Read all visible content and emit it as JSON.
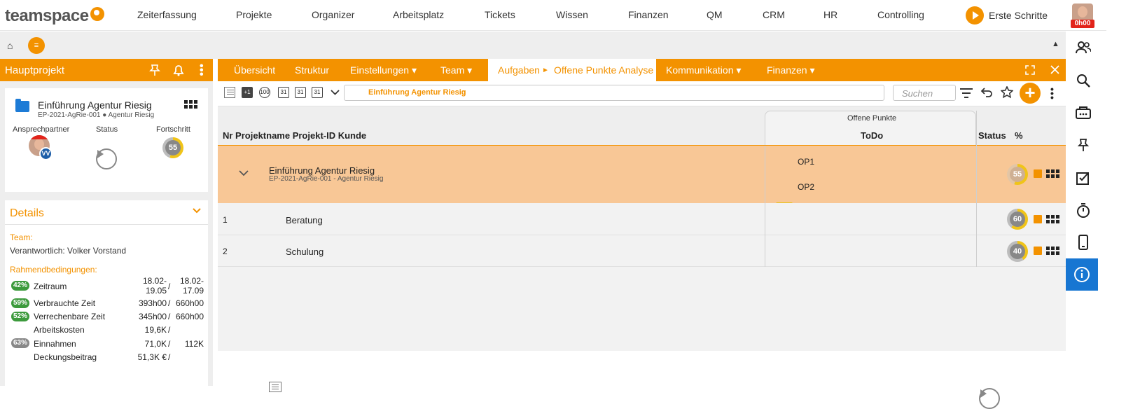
{
  "app": {
    "logo_text": "teamspace"
  },
  "topnav": {
    "items": [
      "Zeiterfassung",
      "Projekte",
      "Organizer",
      "Arbeitsplatz",
      "Tickets",
      "Wissen",
      "Finanzen",
      "QM",
      "CRM",
      "HR",
      "Controlling"
    ],
    "erste_schritte": "Erste Schritte",
    "timer": "0h00"
  },
  "left": {
    "header_title": "Hauptprojekt",
    "project": {
      "name": "Einführung Agentur Riesig",
      "sub": "EP-2021-AgRie-001 ● Agentur Riesig"
    },
    "labels": {
      "ansprechpartner": "Ansprechpartner",
      "status": "Status",
      "fortschritt": "Fortschritt"
    },
    "avatar_initials": "VV",
    "progress": "55",
    "details": {
      "title": "Details",
      "team_label": "Team:",
      "verantwortlich": "Verantwortlich: Volker Vorstand",
      "rahmen_label": "Rahmendbedingungen:",
      "rows": [
        {
          "pill": "42%",
          "pill_color": "#3c9a3c",
          "label": "Zeitraum",
          "v1": "18.02-19.05",
          "sep": "/",
          "v2": "18.02-17.09"
        },
        {
          "pill": "59%",
          "pill_color": "#3c9a3c",
          "label": "Verbrauchte Zeit",
          "v1": "393h00",
          "sep": "/",
          "v2": "660h00"
        },
        {
          "pill": "52%",
          "pill_color": "#3c9a3c",
          "label": "Verrechenbare Zeit",
          "v1": "345h00",
          "sep": "/",
          "v2": "660h00"
        },
        {
          "pill": "",
          "pill_color": "",
          "label": "Arbeitskosten",
          "v1": "19,6K",
          "sep": "/",
          "v2": ""
        },
        {
          "pill": "63%",
          "pill_color": "#888888",
          "label": "Einnahmen",
          "v1": "71,0K",
          "sep": "/",
          "v2": "112K"
        },
        {
          "pill": "",
          "pill_color": "",
          "label": "Deckungsbeitrag",
          "v1": "51,3K €",
          "sep": "/",
          "v2": ""
        }
      ]
    }
  },
  "tabs": {
    "items": [
      "Übersicht",
      "Struktur",
      "Einstellungen ▾",
      "Team ▾"
    ],
    "active": {
      "label": "Aufgaben",
      "arrow": "►",
      "sub": "Offene Punkte Analyse"
    },
    "after": [
      "Kommunikation ▾",
      "Finanzen ▾"
    ]
  },
  "toolbar": {
    "breadcrumb": "Einführung Agentur Riesig",
    "search_placeholder": "Suchen",
    "icon_labels": [
      "+1",
      "100",
      "31",
      "31",
      "31"
    ]
  },
  "table": {
    "headers": {
      "main": "Nr Projektname Projekt-ID Kunde",
      "group": "Offene Punkte",
      "todo": "ToDo",
      "status": "Status",
      "pct": "%"
    },
    "root": {
      "name": "Einführung Agentur Riesig",
      "sub": "EP-2021-AgRie-001 - Agentur Riesig",
      "todos": [
        "OP1",
        "OP2"
      ],
      "progress": "55"
    },
    "rows": [
      {
        "nr": "1",
        "name": "Beratung",
        "progress": "60"
      },
      {
        "nr": "2",
        "name": "Schulung",
        "progress": "40"
      }
    ]
  }
}
